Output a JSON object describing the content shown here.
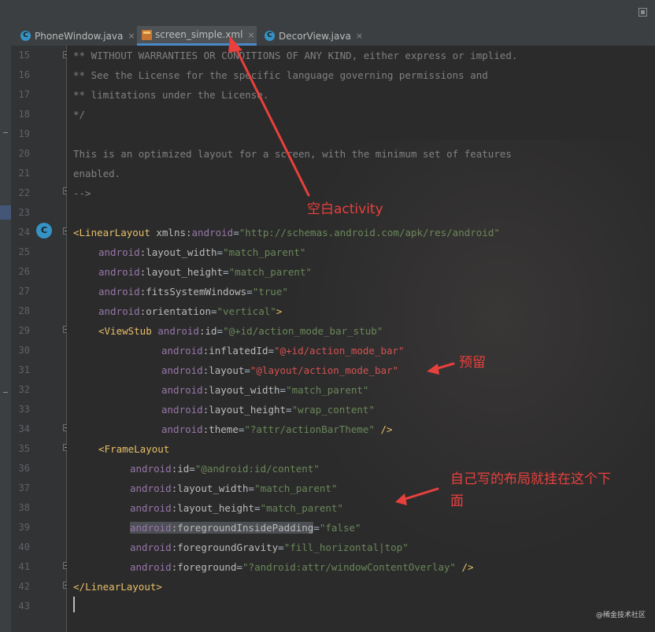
{
  "tabs": [
    {
      "label": "PhoneWindow.java",
      "icon": "java-class-icon"
    },
    {
      "label": "screen_simple.xml",
      "icon": "xml-file-icon",
      "active": true
    },
    {
      "label": "DecorView.java",
      "icon": "java-class-icon"
    }
  ],
  "close_glyph": "×",
  "gutter_badge": "C",
  "line_numbers": [
    "15",
    "16",
    "17",
    "18",
    "19",
    "20",
    "21",
    "22",
    "23",
    "24",
    "25",
    "26",
    "27",
    "28",
    "29",
    "30",
    "31",
    "32",
    "33",
    "34",
    "35",
    "36",
    "37",
    "38",
    "39",
    "40",
    "41",
    "42",
    "43"
  ],
  "code": {
    "l15": "** WITHOUT WARRANTIES OR CONDITIONS OF ANY KIND, either express or implied.",
    "l16": "** See the License for the specific language governing permissions and",
    "l17": "** limitations under the License.",
    "l18": "*/",
    "l20": "This is an optimized layout for a screen, with the minimum set of features",
    "l21": "enabled.",
    "l22": "-->",
    "l24": {
      "lt": "<",
      "tag": "LinearLayout",
      "attr": " xmlns",
      "colon": ":",
      "ns": "android",
      "eq": "=",
      "val": "\"http://schemas.android.com/apk/res/android\""
    },
    "l25": {
      "ns": "android",
      "attr": ":layout_width",
      "eq": "=",
      "val": "\"match_parent\""
    },
    "l26": {
      "ns": "android",
      "attr": ":layout_height",
      "eq": "=",
      "val": "\"match_parent\""
    },
    "l27": {
      "ns": "android",
      "attr": ":fitsSystemWindows",
      "eq": "=",
      "val": "\"true\""
    },
    "l28": {
      "ns": "android",
      "attr": ":orientation",
      "eq": "=",
      "val": "\"vertical\"",
      "end": ">"
    },
    "l29": {
      "lt": "<",
      "tag": "ViewStub",
      "sp": " ",
      "ns": "android",
      "attr": ":id",
      "eq": "=",
      "val": "\"@+id/action_mode_bar_stub\""
    },
    "l30": {
      "ns": "android",
      "attr": ":inflatedId",
      "eq": "=",
      "val": "\"@+id/action_mode_bar\""
    },
    "l31": {
      "ns": "android",
      "attr": ":layout",
      "eq": "=",
      "val": "\"@layout/action_mode_bar\""
    },
    "l32": {
      "ns": "android",
      "attr": ":layout_width",
      "eq": "=",
      "val": "\"match_parent\""
    },
    "l33": {
      "ns": "android",
      "attr": ":layout_height",
      "eq": "=",
      "val": "\"wrap_content\""
    },
    "l34": {
      "ns": "android",
      "attr": ":theme",
      "eq": "=",
      "val": "\"?attr/actionBarTheme\"",
      "end": " />"
    },
    "l35": {
      "lt": "<",
      "tag": "FrameLayout"
    },
    "l36": {
      "ns": "android",
      "attr": ":id",
      "eq": "=",
      "val": "\"@android:id/content\""
    },
    "l37": {
      "ns": "android",
      "attr": ":layout_width",
      "eq": "=",
      "val": "\"match_parent\""
    },
    "l38": {
      "ns": "android",
      "attr": ":layout_height",
      "eq": "=",
      "val": "\"match_parent\""
    },
    "l39": {
      "ns": "android",
      "attr": ":foregroundInsidePadding",
      "eq": "=",
      "val": "\"false\""
    },
    "l40": {
      "ns": "android",
      "attr": ":foregroundGravity",
      "eq": "=",
      "val": "\"fill_horizontal|top\""
    },
    "l41": {
      "ns": "android",
      "attr": ":foreground",
      "eq": "=",
      "val": "\"?android:attr/windowContentOverlay\"",
      "end": " />"
    },
    "l42": {
      "lt": "</",
      "tag": "LinearLayout",
      "end": ">"
    }
  },
  "annotations": {
    "blank_activity": "空白activity",
    "reserved": "预留",
    "own_layout_line1": "自己写的布局就挂在这个下",
    "own_layout_line2": "面"
  },
  "watermark": "@稀金技术社区",
  "colors": {
    "annotation": "#e8403d",
    "editor_bg": "#2b2b2b",
    "tag": "#e8bf6a",
    "string": "#6a8759",
    "namespace": "#9876aa",
    "comment": "#808080"
  }
}
